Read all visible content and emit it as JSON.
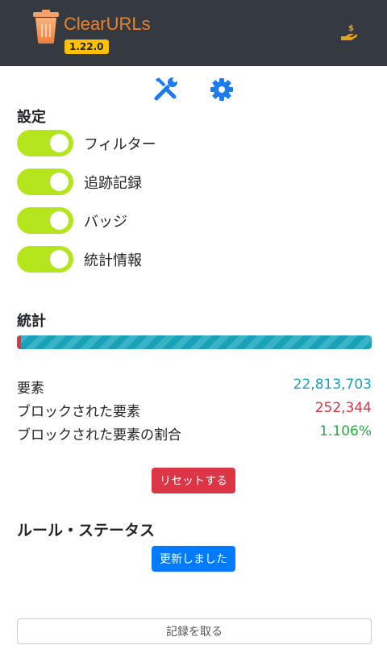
{
  "header": {
    "title": "ClearURLs",
    "version": "1.22.0"
  },
  "settings": {
    "heading": "設定",
    "toggles": [
      {
        "label": "フィルター",
        "on": true
      },
      {
        "label": "追跡記録",
        "on": true
      },
      {
        "label": "バッジ",
        "on": true
      },
      {
        "label": "統計情報",
        "on": true
      }
    ]
  },
  "stats": {
    "heading": "統計",
    "blocked_percent": 1.106,
    "rows": [
      {
        "label": "要素",
        "value": "22,813,703",
        "color": "#17a2b8"
      },
      {
        "label": "ブロックされた要素",
        "value": "252,344",
        "color": "#dc3545"
      },
      {
        "label": "ブロックされた要素の割合",
        "value": "1.106%",
        "color": "#28a745"
      }
    ],
    "reset_label": "リセットする"
  },
  "rules": {
    "heading": "ルール・ステータス",
    "status_label": "更新しました"
  },
  "log_label": "記録を取る"
}
